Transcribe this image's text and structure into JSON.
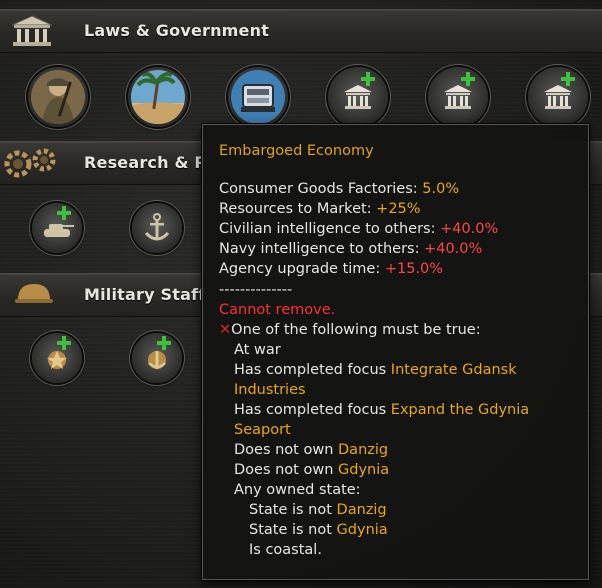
{
  "sections": {
    "laws": {
      "title": "Laws & Government",
      "icon": "government-building-icon"
    },
    "research": {
      "title": "Research & P",
      "icon": "gears-icon"
    },
    "military": {
      "title": "Military Staff",
      "icon": "helmet-icon"
    }
  },
  "tooltip": {
    "title": "Embargoed Economy",
    "modifiers": [
      {
        "label": "Consumer Goods Factories: ",
        "value": "5.0%",
        "color": "#e8a80e"
      },
      {
        "label": "Resources to Market: ",
        "value": "+25%",
        "color": "#e8a80e"
      },
      {
        "label": "Civilian intelligence to others: ",
        "value": "+40.0%",
        "color": "#ff4646"
      },
      {
        "label": "Navy intelligence to others: ",
        "value": "+40.0%",
        "color": "#ff4646"
      },
      {
        "label": "Agency upgrade time: ",
        "value": "+15.0%",
        "color": "#ff4646"
      }
    ],
    "separator": "--------------",
    "cannot_remove": "Cannot remove.",
    "condition_header": "One of the following must be true:",
    "conditions": {
      "at_war": "At war",
      "focus1_prefix": "Has completed focus ",
      "focus1_name_a": "Integrate Gdansk",
      "focus1_name_b": "Industries",
      "focus2_prefix": "Has completed focus ",
      "focus2_name_a": "Expand the Gdynia",
      "focus2_name_b": "Seaport",
      "not_own1_prefix": "Does not own ",
      "not_own1_name": "Danzig",
      "not_own2_prefix": "Does not own ",
      "not_own2_name": "Gdynia",
      "any_owned": "Any owned state:",
      "state1_prefix": "State is not ",
      "state1_name": "Danzig",
      "state2_prefix": "State is not ",
      "state2_name": "Gdynia",
      "coastal": "Is coastal."
    }
  },
  "colors": {
    "highlight": "#e8a80e",
    "negative": "#ff4646",
    "plus_green": "#3ec23e"
  }
}
